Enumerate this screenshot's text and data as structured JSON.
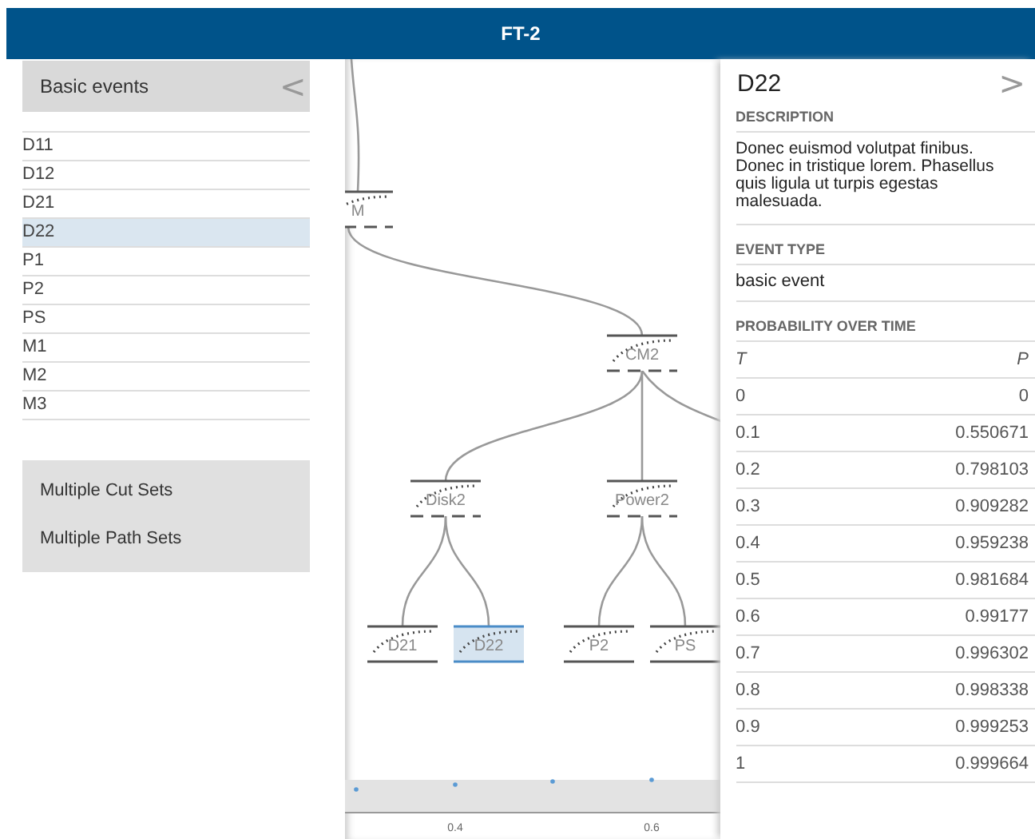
{
  "window": {
    "title": "FT-2"
  },
  "sidebar": {
    "header": "Basic events",
    "collapse_button": "<",
    "items": [
      {
        "label": "D11",
        "selected": false
      },
      {
        "label": "D12",
        "selected": false
      },
      {
        "label": "D21",
        "selected": false
      },
      {
        "label": "D22",
        "selected": true
      },
      {
        "label": "P1",
        "selected": false
      },
      {
        "label": "P2",
        "selected": false
      },
      {
        "label": "PS",
        "selected": false
      },
      {
        "label": "M1",
        "selected": false
      },
      {
        "label": "M2",
        "selected": false
      },
      {
        "label": "M3",
        "selected": false
      }
    ],
    "actions": [
      "Multiple Cut Sets",
      "Multiple Path Sets"
    ]
  },
  "tree": {
    "nodes": [
      {
        "label": "M",
        "selected": false,
        "children": [
          {
            "label": "CM2",
            "selected": false,
            "children": [
              {
                "label": "Disk2",
                "selected": false,
                "children": [
                  {
                    "label": "D21",
                    "selected": false
                  },
                  {
                    "label": "D22",
                    "selected": true
                  }
                ]
              },
              {
                "label": "Power2",
                "selected": false,
                "children": [
                  {
                    "label": "P2",
                    "selected": false
                  },
                  {
                    "label": "PS",
                    "selected": false
                  }
                ]
              }
            ]
          }
        ]
      }
    ]
  },
  "timeline": {
    "ticks": [
      "0.4",
      "0.6"
    ]
  },
  "details": {
    "title": "D22",
    "expand_button": ">",
    "description_label": "DESCRIPTION",
    "description": "Donec euismod volutpat finibus. Donec in tristique lorem. Phasellus quis ligula ut turpis egestas malesuada.",
    "event_type_label": "EVENT TYPE",
    "event_type": "basic event",
    "probability_label": "PROBABILITY OVER TIME",
    "table": {
      "columns": [
        "T",
        "P"
      ],
      "rows": [
        [
          "0",
          "0"
        ],
        [
          "0.1",
          "0.550671"
        ],
        [
          "0.2",
          "0.798103"
        ],
        [
          "0.3",
          "0.909282"
        ],
        [
          "0.4",
          "0.959238"
        ],
        [
          "0.5",
          "0.981684"
        ],
        [
          "0.6",
          "0.99177"
        ],
        [
          "0.7",
          "0.996302"
        ],
        [
          "0.8",
          "0.998338"
        ],
        [
          "0.9",
          "0.999253"
        ],
        [
          "1",
          "0.999664"
        ]
      ]
    }
  }
}
